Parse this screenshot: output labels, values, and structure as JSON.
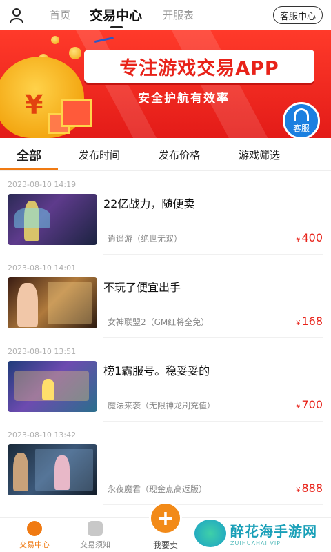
{
  "topnav": {
    "tabs": [
      "首页",
      "交易中心",
      "开服表"
    ],
    "active_tab": "交易中心",
    "service_button": "客服中心"
  },
  "banner": {
    "headline": "专注游戏交易APP",
    "subline": "安全护航有效率",
    "bag_symbol": "¥",
    "float_service": "客服"
  },
  "filters": {
    "tabs": [
      "全部",
      "发布时间",
      "发布价格",
      "游戏筛选"
    ]
  },
  "listings": [
    {
      "time": "2023-08-10 14:19",
      "title": "22亿战力，随便卖",
      "game": "逍遥游（绝世无双）",
      "currency": "¥",
      "price": "400"
    },
    {
      "time": "2023-08-10 14:01",
      "title": "不玩了便宜出手",
      "game": "女神联盟2（GM红将全免）",
      "currency": "¥",
      "price": "168"
    },
    {
      "time": "2023-08-10 13:51",
      "title": "榜1霸服号。稳妥妥的",
      "game": "魔法来袭（无限神龙刷充值）",
      "currency": "¥",
      "price": "700"
    },
    {
      "time": "2023-08-10 13:42",
      "title": "",
      "game": "永夜魔君（现金点高返版）",
      "currency": "¥",
      "price": "888"
    }
  ],
  "bottombar": {
    "items": [
      "交易中心",
      "交易须知",
      "我要卖"
    ],
    "sell_symbol": "+"
  },
  "watermark": {
    "cn": "醉花海手游网",
    "en": "ZUIHUAHAI VIP"
  },
  "colors": {
    "accent": "#f07a12",
    "price": "#e8231a",
    "banner": "#e31b18"
  }
}
